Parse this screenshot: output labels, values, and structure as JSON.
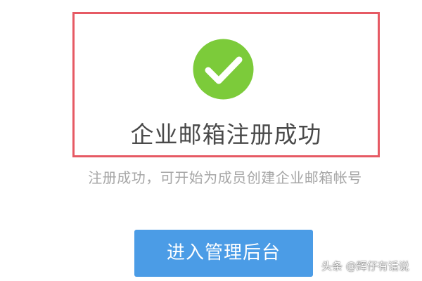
{
  "success": {
    "icon": "check-circle-icon",
    "icon_color": "#7ccb3a",
    "title": "企业邮箱注册成功",
    "subtitle": "注册成功，可开始为成员创建企业邮箱帐号"
  },
  "actions": {
    "enter_admin_label": "进入管理后台"
  },
  "colors": {
    "highlight_border": "#e65a64",
    "button_bg": "#4b9ce6"
  },
  "watermark": {
    "text": "头条 @辉仔有话说"
  }
}
